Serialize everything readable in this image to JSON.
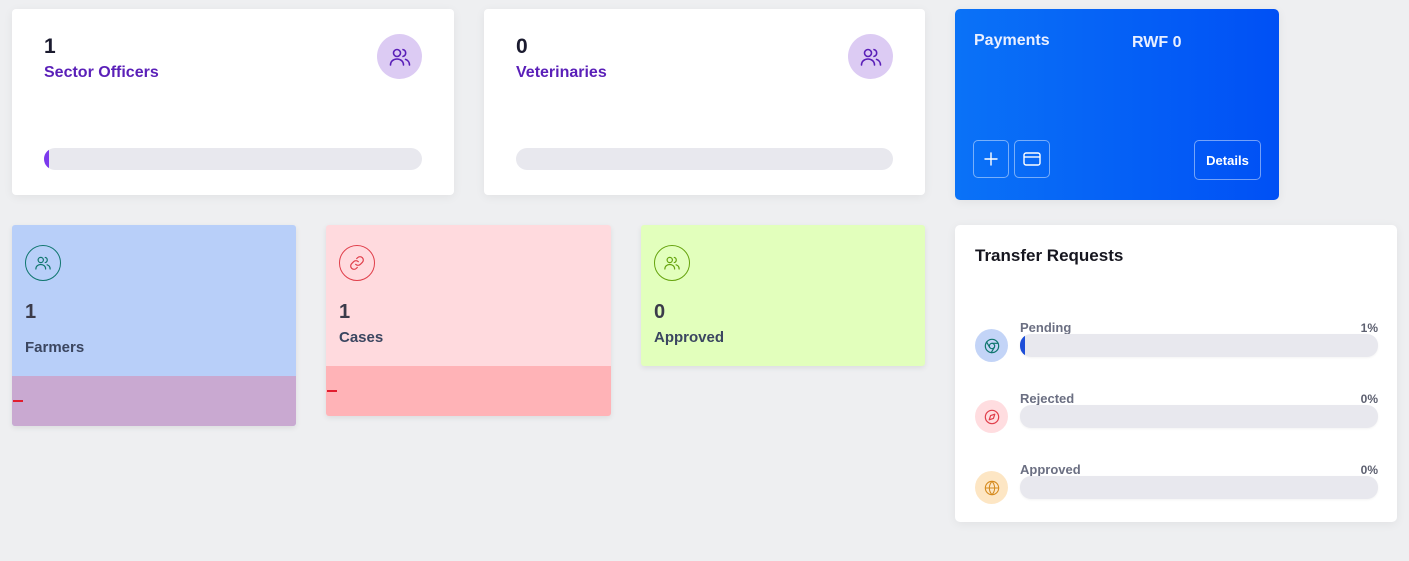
{
  "stats": [
    {
      "count": "1",
      "label": "Sector Officers",
      "icon": "users-icon",
      "progress": 0.01
    },
    {
      "count": "0",
      "label": "Veterinaries",
      "icon": "users-icon",
      "progress": 0
    }
  ],
  "payments": {
    "title": "Payments",
    "amount": "RWF 0",
    "add_icon": "plus-icon",
    "card_icon": "credit-card-icon",
    "details_label": "Details"
  },
  "mini_cards": [
    {
      "count": "1",
      "label": "Farmers",
      "icon": "users-icon",
      "bg": "#b8cff9",
      "bottom_bg": "#c9a9d1",
      "icon_color": "#0f766e"
    },
    {
      "count": "1",
      "label": "Cases",
      "icon": "link-icon",
      "bg": "#ffdade",
      "bottom_bg": "#ffb3b7",
      "icon_color": "#e03e4a"
    },
    {
      "count": "0",
      "label": "Approved",
      "icon": "users-icon",
      "bg": "#e2ffbc",
      "icon_color": "#65a30d"
    }
  ],
  "transfer_requests": {
    "title": "Transfer Requests",
    "items": [
      {
        "label": "Pending",
        "percent": "1%",
        "progress": 0.01,
        "icon": "chrome-icon",
        "icon_bg": "#c3d4f7",
        "icon_color": "#0f766e"
      },
      {
        "label": "Rejected",
        "percent": "0%",
        "progress": 0,
        "icon": "compass-icon",
        "icon_bg": "#ffdde0",
        "icon_color": "#e03e4a"
      },
      {
        "label": "Approved",
        "percent": "0%",
        "progress": 0,
        "icon": "globe-icon",
        "icon_bg": "#fde6c4",
        "icon_color": "#d58a1e"
      }
    ]
  },
  "colors": {
    "accent_purple": "#5a1fb8",
    "payments_blue": "#0a6cf7",
    "progress_blue": "#1d4ed8"
  }
}
